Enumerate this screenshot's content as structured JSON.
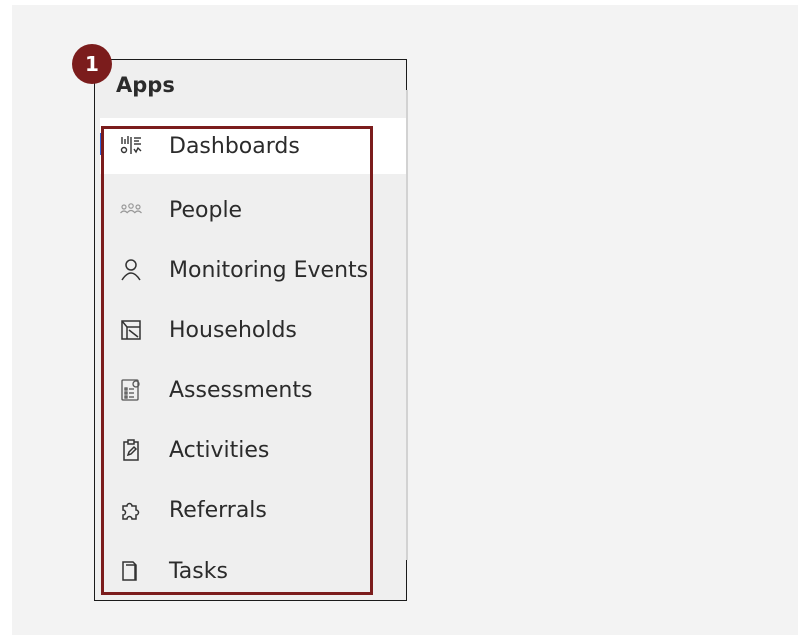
{
  "panel": {
    "title": "Apps"
  },
  "menu": {
    "items": [
      {
        "label": "Dashboards",
        "icon": "dashboard-icon",
        "active": true
      },
      {
        "label": "People",
        "icon": "people-icon",
        "active": false
      },
      {
        "label": "Monitoring Events",
        "icon": "person-icon",
        "active": false
      },
      {
        "label": "Households",
        "icon": "household-icon",
        "active": false
      },
      {
        "label": "Assessments",
        "icon": "assessment-icon",
        "active": false
      },
      {
        "label": "Activities",
        "icon": "clipboard-icon",
        "active": false
      },
      {
        "label": "Referrals",
        "icon": "puzzle-icon",
        "active": false
      },
      {
        "label": "Tasks",
        "icon": "tasks-icon",
        "active": false
      }
    ]
  },
  "annotation": {
    "callout_number": "1"
  },
  "colors": {
    "highlight": "#7b1c1c",
    "active_indicator": "#2d63d8",
    "panel_bg": "#efefef"
  }
}
